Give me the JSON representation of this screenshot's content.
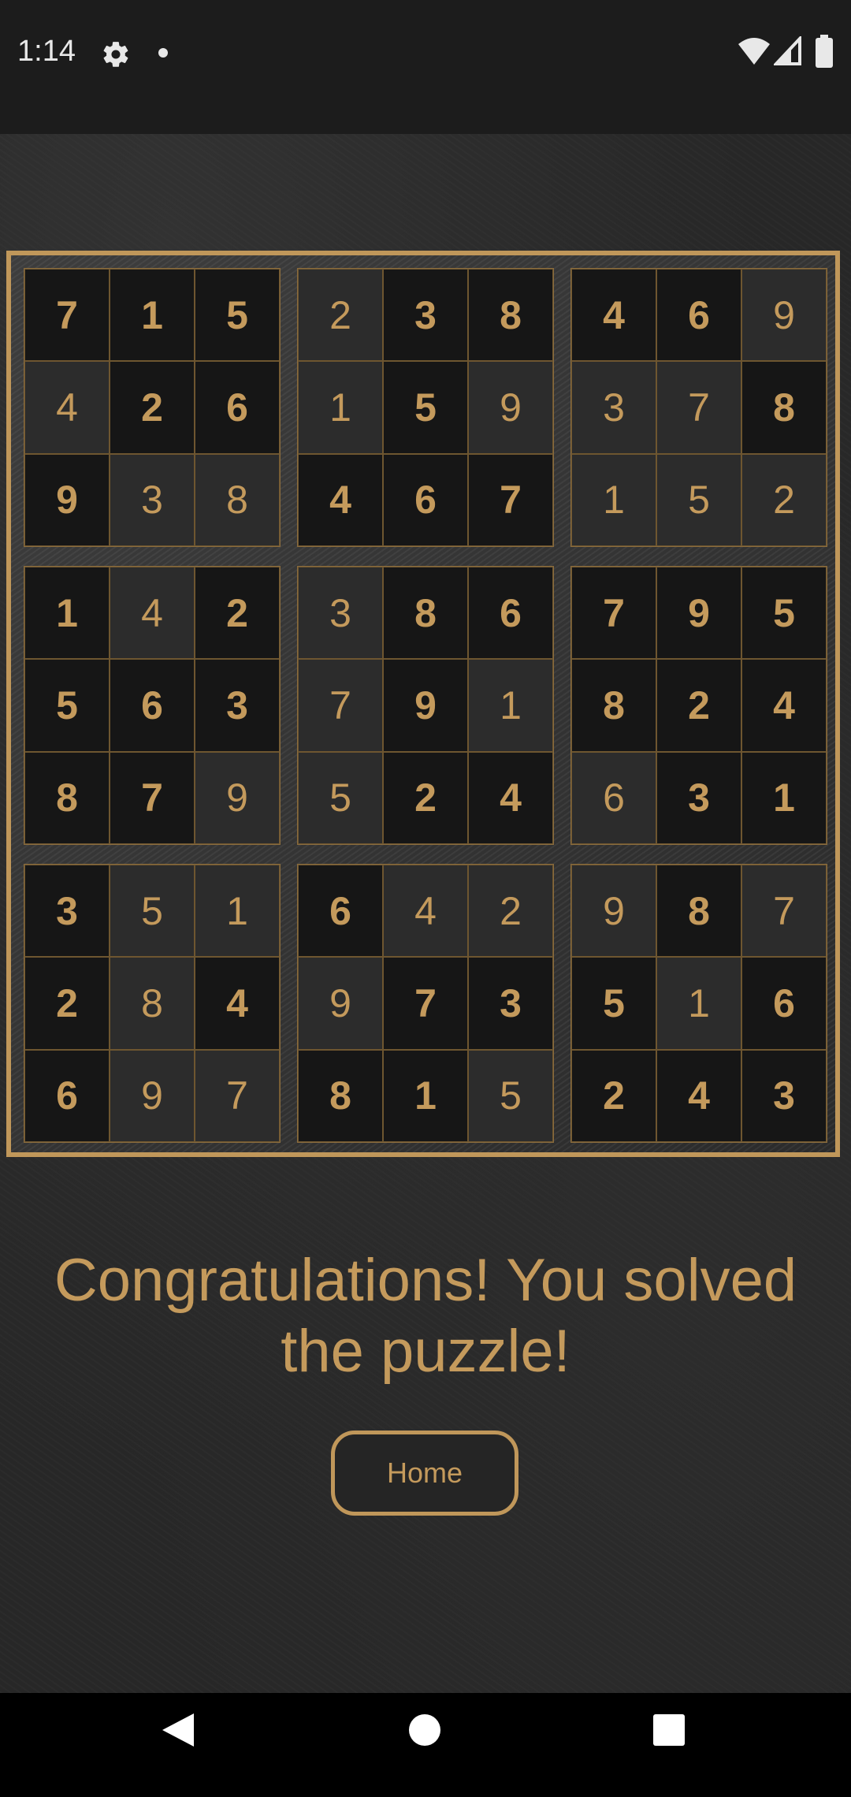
{
  "status_bar": {
    "time": "1:14"
  },
  "board": {
    "rows": [
      [
        "7",
        "1",
        "5",
        "2",
        "3",
        "8",
        "4",
        "6",
        "9"
      ],
      [
        "4",
        "2",
        "6",
        "1",
        "5",
        "9",
        "3",
        "7",
        "8"
      ],
      [
        "9",
        "3",
        "8",
        "4",
        "6",
        "7",
        "1",
        "5",
        "2"
      ],
      [
        "1",
        "4",
        "2",
        "3",
        "8",
        "6",
        "7",
        "9",
        "5"
      ],
      [
        "5",
        "6",
        "3",
        "7",
        "9",
        "1",
        "8",
        "2",
        "4"
      ],
      [
        "8",
        "7",
        "9",
        "5",
        "2",
        "4",
        "6",
        "3",
        "1"
      ],
      [
        "3",
        "5",
        "1",
        "6",
        "4",
        "2",
        "9",
        "8",
        "7"
      ],
      [
        "2",
        "8",
        "4",
        "9",
        "7",
        "3",
        "5",
        "1",
        "6"
      ],
      [
        "6",
        "9",
        "7",
        "8",
        "1",
        "5",
        "2",
        "4",
        "3"
      ]
    ],
    "given": [
      [
        1,
        1,
        1,
        0,
        1,
        1,
        1,
        1,
        0
      ],
      [
        0,
        1,
        1,
        0,
        1,
        0,
        0,
        0,
        1
      ],
      [
        1,
        0,
        0,
        1,
        1,
        1,
        0,
        0,
        0
      ],
      [
        1,
        0,
        1,
        0,
        1,
        1,
        1,
        1,
        1
      ],
      [
        1,
        1,
        1,
        0,
        1,
        0,
        1,
        1,
        1
      ],
      [
        1,
        1,
        0,
        0,
        1,
        1,
        0,
        1,
        1
      ],
      [
        1,
        0,
        0,
        1,
        0,
        0,
        0,
        1,
        0
      ],
      [
        1,
        0,
        1,
        0,
        1,
        1,
        1,
        0,
        1
      ],
      [
        1,
        0,
        0,
        1,
        1,
        0,
        1,
        1,
        1
      ]
    ]
  },
  "message": "Congratulations! You solved the puzzle!",
  "home_button": {
    "label": "Home"
  },
  "colors": {
    "accent": "#c0975a",
    "given_cell": "#161616",
    "filled_cell": "#2c2c2c"
  }
}
